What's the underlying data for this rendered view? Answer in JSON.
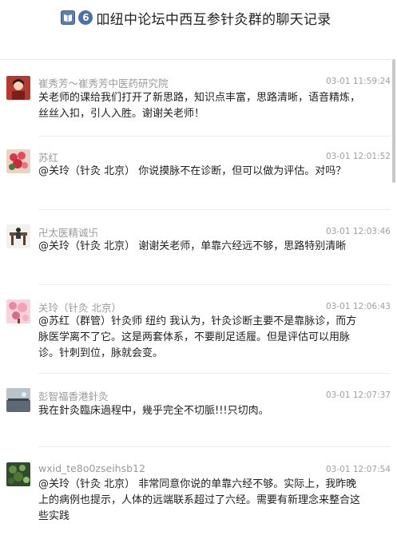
{
  "header": {
    "title": "6 2纽中论坛中西互参针灸群的聊天记录",
    "title_text": "吅纽中论坛中西互参针灸群的聊天记录",
    "badge_number": "6"
  },
  "messages": [
    {
      "name": "崔秀芳～崔秀芳中医药研究院",
      "time": "03-01 11:59:24",
      "body": "关老师的课给我们打开了新思路，知识点丰富，思路清晰，语音精炼，丝丝入扣，引人入胜。谢谢关老师！"
    },
    {
      "name": "苏红",
      "time": "03-01 12:01:52",
      "body": "@关玲（针灸 北京） 你说摸脉不在诊断，但可以做为评估。对吗？"
    },
    {
      "name": "卍太医精诚卐",
      "time": "03-01 12:03:46",
      "body": "@关玲（针灸 北京） 谢谢关老师，单靠六经远不够，思路特别清晰"
    },
    {
      "name": "关玲（针灸 北京）",
      "time": "03-01 12:06:43",
      "body": "@苏红（群管）针灸师 纽约 我认为，针灸诊断主要不是靠脉诊，而方脉医学离不了它。这是两套体系，不要削足适履。但是评估可以用脉诊。针刺到位，脉就会变。"
    },
    {
      "name": "彭智福香港針灸",
      "time": "03-01 12:07:37",
      "body": "我在針灸臨床過程中，幾乎完全不切脈!!!只切肉。"
    },
    {
      "name": "wxid_te8o0zseihsb12",
      "time": "03-01 12:07:54",
      "body": "@关玲（针灸 北京） 非常同意你说的单靠六经不够。实际上，我昨晚上的病例也提示，人体的远端联系超过了六经。需要有新理念来整合这些实践"
    }
  ]
}
